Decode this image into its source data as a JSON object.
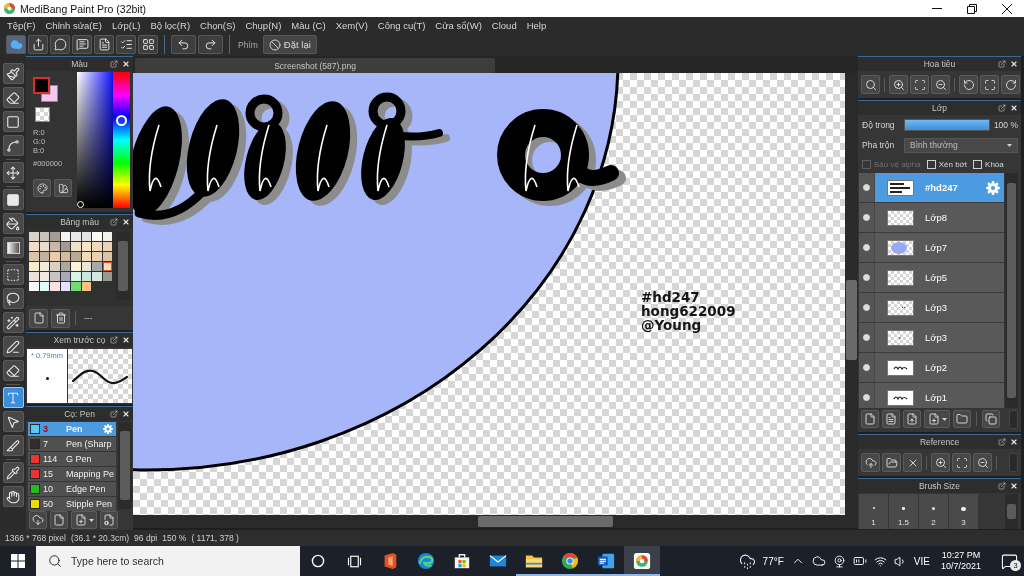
{
  "window": {
    "title": "MediBang Paint Pro (32bit)"
  },
  "menu_bar": [
    "Tệp(F)",
    "Chỉnh sửa(E)",
    "Lớp(L)",
    "Bộ lọc(R)",
    "Chọn(S)",
    "Chụp(N)",
    "Màu (C)",
    "Xem(V)",
    "Công cụ(T)",
    "Cửa sổ(W)",
    "Cloud",
    "Help"
  ],
  "toolbar": {
    "groups": [
      {
        "buttons": [
          {
            "kind": "cloud",
            "on": true
          },
          {
            "kind": "export",
            "on": false
          },
          {
            "kind": "bubble",
            "on": false
          },
          {
            "kind": "comment",
            "on": false
          },
          {
            "kind": "page",
            "on": false
          },
          {
            "kind": "list",
            "on": false
          },
          {
            "kind": "grid",
            "on": false
          }
        ]
      },
      {
        "buttons": [
          {
            "kind": "undo",
            "on": false
          },
          {
            "kind": "redo",
            "on": false
          }
        ]
      }
    ],
    "shortcut_label": "Phím",
    "reset_button": "Đặt lại"
  },
  "tool_groups": [
    {
      "tools": [
        {
          "kind": "brush",
          "selected": false
        },
        {
          "kind": "eraser",
          "selected": false
        },
        {
          "kind": "shape",
          "selected": false
        },
        {
          "kind": "curve",
          "selected": false
        }
      ]
    },
    {
      "tools": [
        {
          "kind": "move",
          "selected": false
        }
      ]
    },
    {
      "tools": [
        {
          "kind": "fill",
          "selected": false
        },
        {
          "kind": "bucket",
          "selected": false
        },
        {
          "kind": "gradient",
          "selected": false
        }
      ]
    },
    {
      "tools": [
        {
          "kind": "select",
          "selected": false
        },
        {
          "kind": "lasso",
          "selected": false
        },
        {
          "kind": "wand",
          "selected": false
        },
        {
          "kind": "select_pen",
          "selected": false
        },
        {
          "kind": "select_eraser",
          "selected": false
        }
      ]
    },
    {
      "tools": [
        {
          "kind": "text",
          "selected": true
        },
        {
          "kind": "operation",
          "selected": false
        },
        {
          "kind": "divide",
          "selected": false
        }
      ]
    },
    {
      "tools": [
        {
          "kind": "eyedropper",
          "selected": false
        },
        {
          "kind": "hand",
          "selected": false
        }
      ]
    }
  ],
  "color_panel": {
    "title": "Màu",
    "swatches": [
      {
        "kind": "main",
        "color": "#000000",
        "selected": true
      },
      {
        "kind": "sub",
        "color": "#f2c6f2",
        "selected": false
      },
      {
        "kind": "transparent",
        "selected": false
      }
    ],
    "rgb": [
      "R:0",
      "G:0",
      "B:0"
    ],
    "hex": "#000000",
    "hue_slider": {
      "level": 0.64
    }
  },
  "palette_panel": {
    "title": "Bảng màu",
    "swatches": [
      {
        "color": "#d9d3cb",
        "selected": false
      },
      {
        "color": "#c9c3bb",
        "selected": false
      },
      {
        "color": "#a29e97",
        "selected": false
      },
      {
        "color": "#f3f3f3",
        "selected": false
      },
      {
        "color": "#e9e9e9",
        "selected": false
      },
      {
        "color": "#e3e3e3",
        "selected": false
      },
      {
        "color": "#faf8f2",
        "selected": false
      },
      {
        "color": "#f4f1ea",
        "selected": false
      },
      {
        "color": "#f1dcc5",
        "selected": false
      },
      {
        "color": "#e9dccc",
        "selected": false
      },
      {
        "color": "#c7b9a9",
        "selected": false
      },
      {
        "color": "#a59a8d",
        "selected": false
      },
      {
        "color": "#f2e2cc",
        "selected": false
      },
      {
        "color": "#f8e2c4",
        "selected": false
      },
      {
        "color": "#f1dabc",
        "selected": false
      },
      {
        "color": "#e9d3ba",
        "selected": false
      },
      {
        "color": "#d9c3aa",
        "selected": false
      },
      {
        "color": "#c0b2a2",
        "selected": false
      },
      {
        "color": "#ebcaa8",
        "selected": false
      },
      {
        "color": "#d2bc9c",
        "selected": false
      },
      {
        "color": "#b9ab93",
        "selected": false
      },
      {
        "color": "#f1d9bb",
        "selected": false
      },
      {
        "color": "#ead1b2",
        "selected": false
      },
      {
        "color": "#dbc3a3",
        "selected": false
      },
      {
        "color": "#faeacc",
        "selected": false
      },
      {
        "color": "#f1eadc",
        "selected": false
      },
      {
        "color": "#d9d2c3",
        "selected": false
      },
      {
        "color": "#a9a9a0",
        "selected": false
      },
      {
        "color": "#fbf2dc",
        "selected": false
      },
      {
        "color": "#e8e8da",
        "selected": false
      },
      {
        "color": "#a8a8a8",
        "selected": false
      },
      {
        "color": "#fbd9b8",
        "selected": true
      },
      {
        "color": "#e9e2db",
        "selected": false
      },
      {
        "color": "#f2ebe4",
        "selected": false
      },
      {
        "color": "#c9c3c3",
        "selected": false
      },
      {
        "color": "#aaaabb",
        "selected": false
      },
      {
        "color": "#dbf2ea",
        "selected": false
      },
      {
        "color": "#cbe9db",
        "selected": false
      },
      {
        "color": "#d2eae2",
        "selected": false
      },
      {
        "color": "#929a92",
        "selected": false
      },
      {
        "color": "#f2fafa",
        "selected": false
      },
      {
        "color": "#e2fafa",
        "selected": false
      },
      {
        "color": "#fae2e2",
        "selected": false
      },
      {
        "color": "#e2e2fa",
        "selected": false
      },
      {
        "color": "#72da72",
        "selected": false
      },
      {
        "color": "#fac282",
        "selected": false
      }
    ],
    "footer_label": "---"
  },
  "brush_preview": {
    "title": "Xem trước cọ",
    "size": "* 0.79mm"
  },
  "brush_panel": {
    "title": "Cọ: Pen",
    "items": [
      {
        "color": "#5bc8ef",
        "size": "3",
        "name": "Pen",
        "selected": true
      },
      {
        "color": "#2e2e2e",
        "size": "7",
        "name": "Pen (Sharp",
        "selected": false
      },
      {
        "color": "#ee3333",
        "size": "114",
        "name": "G Pen",
        "selected": false
      },
      {
        "color": "#ee3333",
        "size": "15",
        "name": "Mapping Pe",
        "selected": false
      },
      {
        "color": "#22bb22",
        "size": "10",
        "name": "Edge Pen",
        "selected": false
      },
      {
        "color": "#eedd00",
        "size": "50",
        "name": "Stipple Pen",
        "selected": false
      }
    ]
  },
  "canvas": {
    "tab": "Screenshot (587).png",
    "text_lines": [
      "#hd247",
      "hong622009",
      "@Young"
    ]
  },
  "navigator": {
    "title": "Hoa tiêu"
  },
  "layers": {
    "title": "Lớp",
    "opacity": {
      "label": "Độ trong",
      "level": 1,
      "reading": "100 %"
    },
    "blend": {
      "label": "Pha trộn",
      "value": "Bình thường"
    },
    "options": [
      {
        "label": "Bảo vệ alpha",
        "checked": false,
        "disabled": true
      },
      {
        "label": "Xén bớt",
        "checked": false,
        "disabled": false
      },
      {
        "label": "Khóa",
        "checked": false,
        "disabled": false
      }
    ],
    "items": [
      {
        "name": "#hd247",
        "kind": "text",
        "visible": true,
        "selected": true
      },
      {
        "name": "Lớp8",
        "kind": "empty",
        "visible": true,
        "selected": false
      },
      {
        "name": "Lớp7",
        "kind": "circle",
        "visible": true,
        "selected": false
      },
      {
        "name": "Lớp5",
        "kind": "empty",
        "visible": true,
        "selected": false
      },
      {
        "name": "Lớp3",
        "kind": "marks",
        "visible": true,
        "selected": false
      },
      {
        "name": "Lớp3",
        "kind": "dot",
        "visible": true,
        "selected": false
      },
      {
        "name": "Lớp2",
        "kind": "script",
        "visible": true,
        "selected": false
      },
      {
        "name": "Lớp1",
        "kind": "script",
        "visible": true,
        "selected": false
      }
    ]
  },
  "reference": {
    "title": "Reference"
  },
  "brush_size": {
    "title": "Brush Size",
    "sizes": [
      "1",
      "1.5",
      "2",
      "3"
    ]
  },
  "status_bar": [
    "1366 * 768 pixel",
    "(36.1 * 20.3cm)",
    "96 dpi",
    "150 %",
    "( 1171, 378 )"
  ],
  "taskbar": {
    "search_placeholder": "Type here to search",
    "apps": [
      {
        "kind": "cortana",
        "running": false,
        "selected": false
      },
      {
        "kind": "taskview",
        "running": false,
        "selected": false
      },
      {
        "kind": "office",
        "running": false,
        "selected": false
      },
      {
        "kind": "edge",
        "running": false,
        "selected": false
      },
      {
        "kind": "store",
        "running": false,
        "selected": false
      },
      {
        "kind": "mail",
        "running": false,
        "selected": false
      },
      {
        "kind": "explorer",
        "running": true,
        "selected": false
      },
      {
        "kind": "chrome",
        "running": true,
        "selected": false
      },
      {
        "kind": "word",
        "running": true,
        "selected": false
      },
      {
        "kind": "medibang",
        "running": true,
        "selected": true
      }
    ],
    "weather": "77°F",
    "language": "VIE",
    "time": "10:27 PM",
    "date": "10/7/2021",
    "notifications": "3"
  }
}
